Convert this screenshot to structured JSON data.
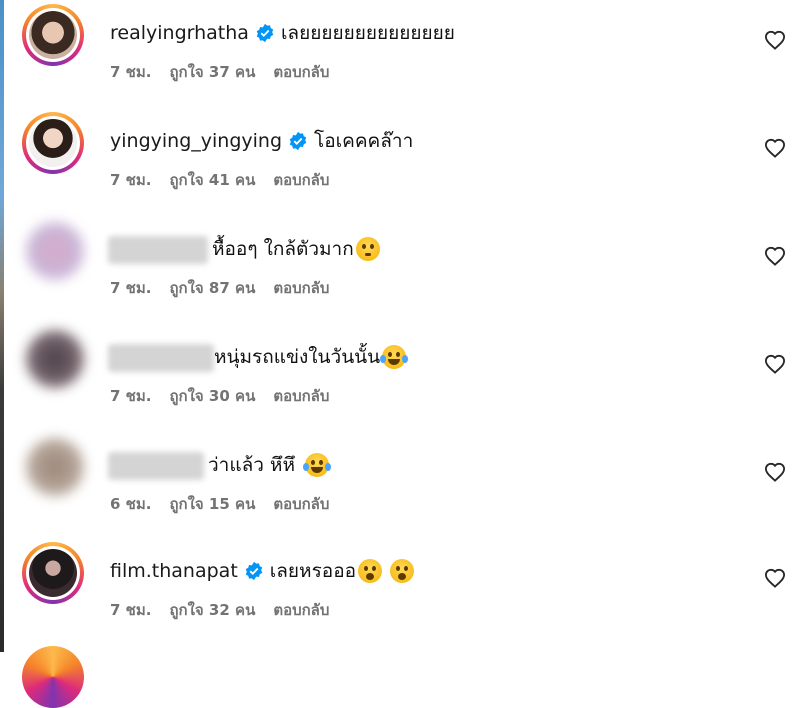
{
  "comments": [
    {
      "username": "realyingrhatha",
      "verified": true,
      "text": "เลยยยยยยยยยยยยยย",
      "emojis": [],
      "time": "7 ชม.",
      "likes": "ถูกใจ 37 คน",
      "reply": "ตอบกลับ",
      "blurred": false
    },
    {
      "username": "yingying_yingying",
      "verified": true,
      "text": "โอเคคคล๊าา",
      "emojis": [],
      "time": "7 ชม.",
      "likes": "ถูกใจ 41 คน",
      "reply": "ตอบกลับ",
      "blurred": false
    },
    {
      "username": "",
      "verified": false,
      "text": "หื้ออๆ ใกล้ตัวมาก",
      "emojis": [
        "flushed-face-emoji"
      ],
      "time": "7 ชม.",
      "likes": "ถูกใจ 87 คน",
      "reply": "ตอบกลับ",
      "blurred": true
    },
    {
      "username": "",
      "verified": false,
      "text": "หนุ่มรถแข่งในวันนั้น",
      "emojis": [
        "tears-of-joy-emoji"
      ],
      "time": "7 ชม.",
      "likes": "ถูกใจ 30 คน",
      "reply": "ตอบกลับ",
      "blurred": true
    },
    {
      "username": "",
      "verified": false,
      "text": "ว่าแล้ว หึหึ",
      "emojis": [
        "tears-of-joy-emoji"
      ],
      "time": "6 ชม.",
      "likes": "ถูกใจ 15 คน",
      "reply": "ตอบกลับ",
      "blurred": true
    },
    {
      "username": "film.thanapat",
      "verified": true,
      "text": "เลยหรอออ",
      "emojis": [
        "surprised-face-emoji",
        "surprised-face-emoji"
      ],
      "time": "7 ชม.",
      "likes": "ถูกใจ 32 คน",
      "reply": "ตอบกลับ",
      "blurred": false
    }
  ],
  "colors": {
    "meta_text": "#737373",
    "verified_badge": "#0095f6",
    "story_ring_start": "#fdb94c",
    "story_ring_end": "#8134af"
  }
}
